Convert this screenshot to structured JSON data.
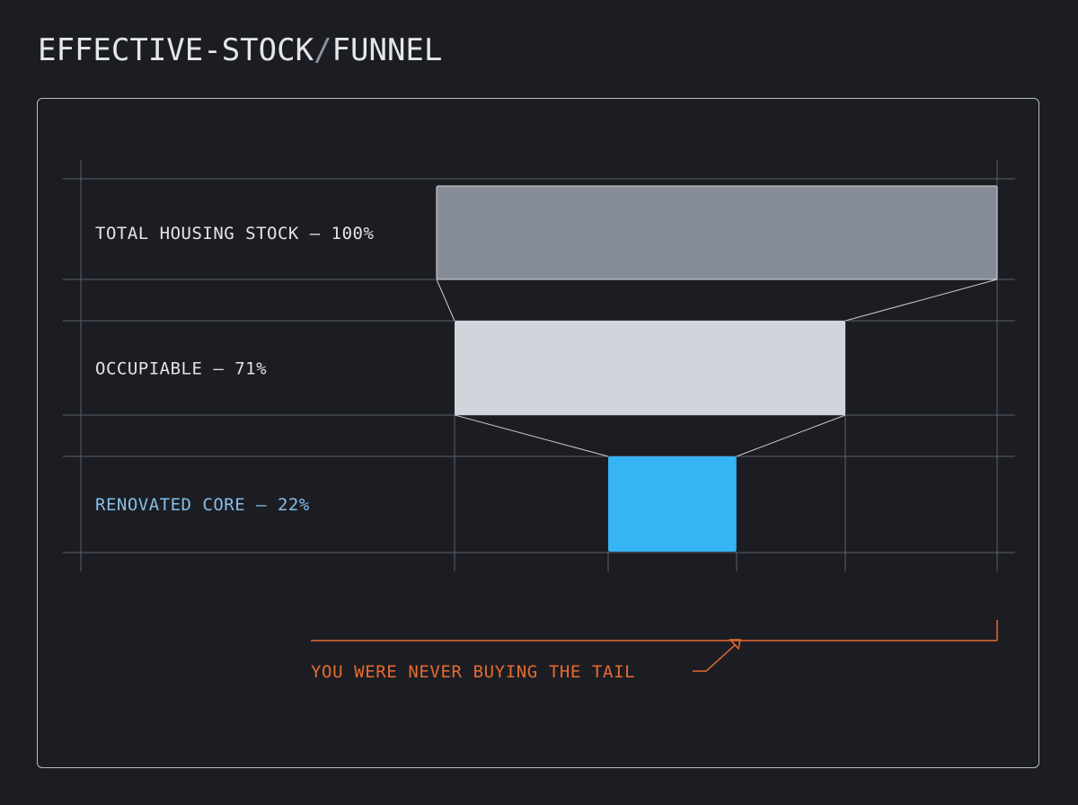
{
  "title": {
    "left": "EFFECTIVE-STOCK",
    "separator": "/",
    "right": "FUNNEL"
  },
  "chart_data": {
    "type": "funnel",
    "title": "EFFECTIVE-STOCK/FUNNEL",
    "stages": [
      {
        "name": "TOTAL HOUSING STOCK",
        "value": 100,
        "label": "TOTAL HOUSING STOCK — 100%"
      },
      {
        "name": "OCCUPIABLE",
        "value": 71,
        "label": "OCCUPIABLE — 71%"
      },
      {
        "name": "RENOVATED CORE",
        "value": 22,
        "label": "RENOVATED CORE — 22%"
      }
    ],
    "unit": "%",
    "highlight_stage": "RENOVATED CORE",
    "annotation": "YOU WERE NEVER BUYING THE TAIL",
    "grid": true
  },
  "colors": {
    "background": "#1c1d23",
    "grid": "#5c606b",
    "stage_total": "#878d98",
    "stage_occupiable": "#d1d4da",
    "stage_core": "#36b4f4",
    "label": "#e2e4ea",
    "label_highlight": "#86bde6",
    "annotation": "#e76a2f"
  }
}
